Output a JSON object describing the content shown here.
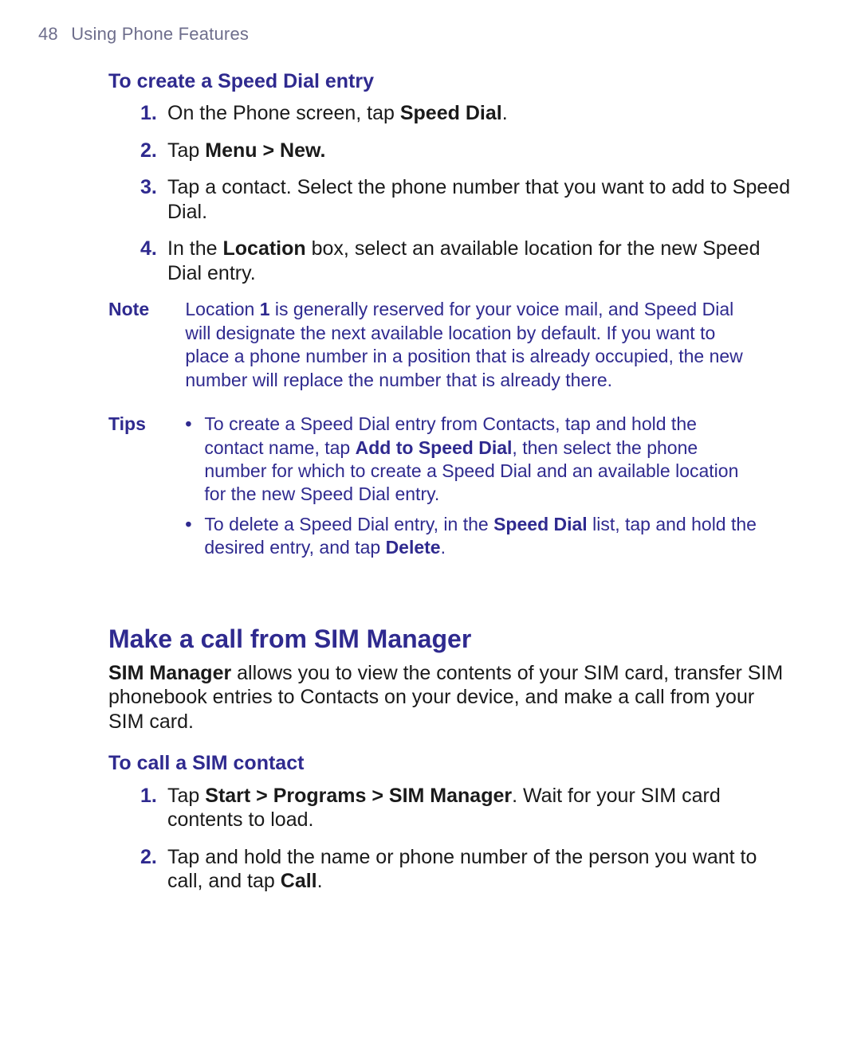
{
  "header": {
    "page_number": "48",
    "chapter": "Using Phone Features"
  },
  "speed_dial": {
    "heading": "To create a Speed Dial entry",
    "steps": [
      {
        "num": "1.",
        "pre": "On the Phone screen, tap ",
        "bold": "Speed Dial",
        "post": "."
      },
      {
        "num": "2.",
        "pre": "Tap ",
        "bold": "Menu > New.",
        "post": ""
      },
      {
        "num": "3.",
        "pre": "Tap a contact. Select the phone number that you want to add to Speed Dial.",
        "bold": "",
        "post": ""
      },
      {
        "num": "4.",
        "pre": "In the ",
        "bold": "Location",
        "post": " box, select an available location for the new Speed Dial entry."
      }
    ],
    "note_label": "Note",
    "note": {
      "pre": "Location ",
      "bold": "1",
      "post": " is generally reserved for your voice mail, and Speed Dial will designate the next available location by default. If you want to place a phone number in a position that is already occupied, the new number will replace the number that is already there."
    },
    "tips_label": "Tips",
    "tips": [
      {
        "pre": "To create a Speed Dial entry from Contacts, tap and hold the contact name, tap ",
        "bold": "Add to Speed Dial",
        "post": ", then select the phone number for which to create a Speed Dial and an available location for the new Speed Dial entry."
      },
      {
        "pre": "To delete a Speed Dial entry, in the ",
        "bold": "Speed Dial",
        "mid": " list, tap and hold the desired entry, and tap ",
        "bold2": "Delete",
        "post": "."
      }
    ]
  },
  "sim": {
    "heading": "Make a call from SIM Manager",
    "intro_bold": "SIM Manager",
    "intro_rest": " allows you to view the contents of your SIM card, transfer SIM phonebook entries to Contacts on your device, and make a call from your SIM card.",
    "sub": "To call a SIM contact",
    "steps": [
      {
        "num": "1.",
        "pre": "Tap ",
        "bold": "Start > Programs > SIM Manager",
        "post": ". Wait for your SIM card contents to load."
      },
      {
        "num": "2.",
        "pre": "Tap and hold the name or phone number of the person you want to call, and tap ",
        "bold": "Call",
        "post": "."
      }
    ]
  }
}
